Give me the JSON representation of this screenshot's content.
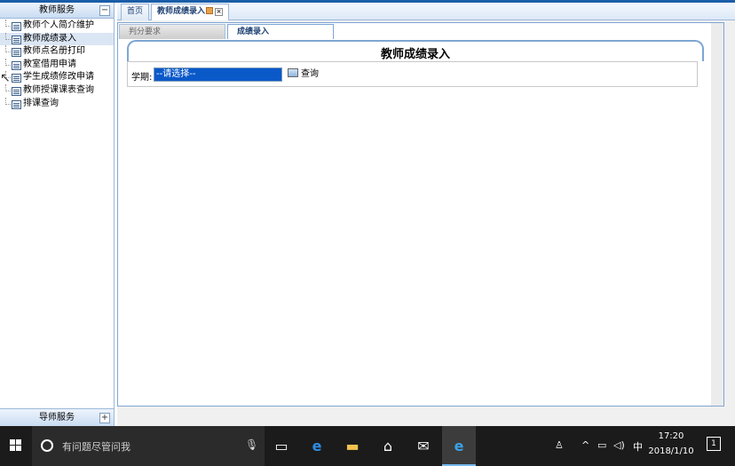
{
  "left_panel": {
    "header": "教师服务",
    "header_toggle": "−",
    "footer": "导师服务",
    "footer_toggle": "+",
    "items": [
      {
        "label": "教师个人简介维护"
      },
      {
        "label": "教师成绩录入"
      },
      {
        "label": "教师点名册打印"
      },
      {
        "label": "教室借用申请"
      },
      {
        "label": "学生成绩修改申请"
      },
      {
        "label": "教师授课课表查询"
      },
      {
        "label": "排课查询"
      }
    ],
    "selected_index": 1
  },
  "tabs": [
    {
      "label": "首页"
    },
    {
      "label": "教师成绩录入"
    }
  ],
  "tab_close": "×",
  "subtabs": [
    {
      "label": "判分要求"
    },
    {
      "label": "成绩录入"
    }
  ],
  "main": {
    "title": "教师成绩录入",
    "term_label": "学期:",
    "term_select_value": "--请选择--",
    "query_label": "查询"
  },
  "taskbar": {
    "search_placeholder": "有问题尽管问我",
    "ime": "中",
    "time": "17:20",
    "date": "2018/1/10",
    "notification_count": "1"
  },
  "colors": {
    "accent": "#7ea6d4",
    "select_bg": "#0a59c9",
    "taskbar": "#1b1b1b"
  }
}
